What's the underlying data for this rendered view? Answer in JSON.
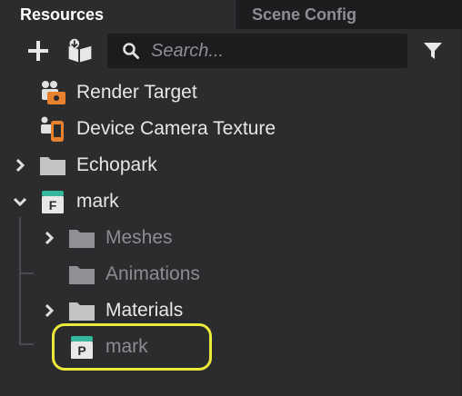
{
  "tabs": [
    {
      "label": "Resources",
      "active": true
    },
    {
      "label": "Scene Config",
      "active": false
    }
  ],
  "toolbar": {
    "add_icon": "plus-icon",
    "import_icon": "library-import-icon",
    "filter_icon": "filter-funnel-icon"
  },
  "search": {
    "placeholder": "Search...",
    "value": ""
  },
  "tree": {
    "items": [
      {
        "label": "Render Target",
        "icon": "render-target-icon",
        "expandable": false,
        "dimmed": false
      },
      {
        "label": "Device Camera Texture",
        "icon": "device-camera-texture-icon",
        "expandable": false,
        "dimmed": false
      },
      {
        "label": "Echopark",
        "icon": "folder-icon",
        "expandable": true,
        "expanded": false,
        "dimmed": false
      },
      {
        "label": "mark",
        "icon": "fbx-file-icon",
        "badge": "F",
        "expandable": true,
        "expanded": true,
        "dimmed": false
      },
      {
        "label": "Meshes",
        "icon": "folder-icon",
        "expandable": true,
        "expanded": false,
        "dimmed": true
      },
      {
        "label": "Animations",
        "icon": "folder-icon",
        "expandable": false,
        "dimmed": true
      },
      {
        "label": "Materials",
        "icon": "folder-icon",
        "expandable": true,
        "expanded": false,
        "dimmed": false
      },
      {
        "label": "mark",
        "icon": "prefab-icon",
        "badge": "P",
        "expandable": false,
        "dimmed": true,
        "highlighted": true
      }
    ]
  },
  "colors": {
    "panel_bg": "#2b2c2e",
    "tab_bar_bg": "#161718",
    "highlight_ring": "#ece93a",
    "file_icon_teal": "#35b79b",
    "camera_orange": "#e8812e",
    "folder_gray": "#c4c4c4"
  }
}
